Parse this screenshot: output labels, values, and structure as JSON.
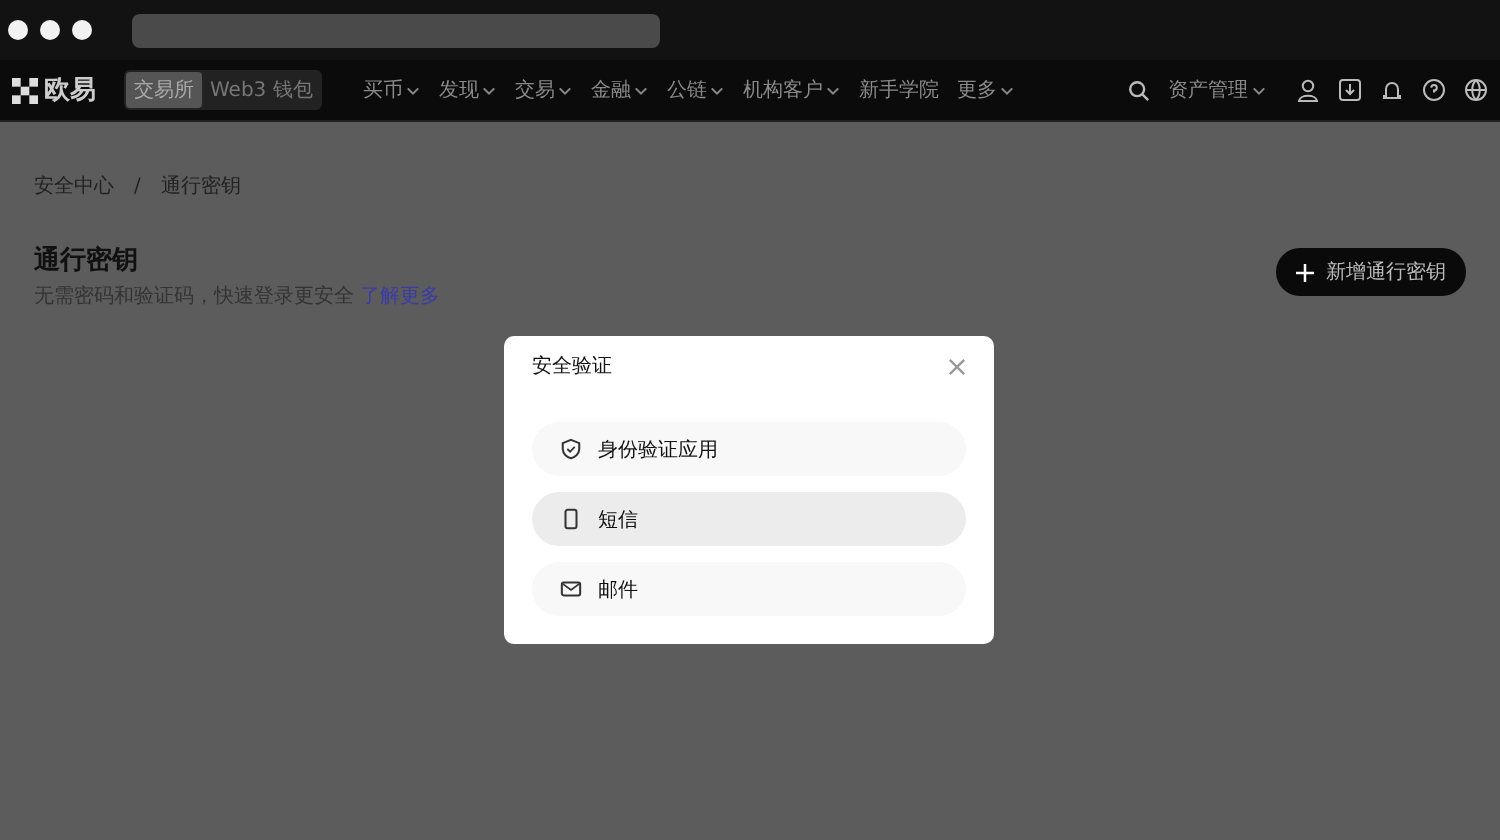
{
  "nav": {
    "logo": "欧易",
    "switch": [
      {
        "label": "交易所",
        "selected": true
      },
      {
        "label": "Web3 钱包",
        "selected": false
      }
    ],
    "menu": [
      {
        "label": "买币"
      },
      {
        "label": "发现"
      },
      {
        "label": "交易"
      },
      {
        "label": "金融"
      },
      {
        "label": "公链"
      },
      {
        "label": "机构客户"
      },
      {
        "label": "新手学院",
        "dropdown": false
      },
      {
        "label": "更多"
      }
    ],
    "assets": "资产管理"
  },
  "breadcrumb": [
    "安全中心",
    "通行密钥"
  ],
  "breadcrumb_separator": "/",
  "header": {
    "title": "通行密钥",
    "description": "无需密码和验证码，快速登录更安全",
    "link": "了解更多",
    "button": "新增通行密钥"
  },
  "dialog": {
    "title": "安全验证",
    "options": [
      {
        "label": "身份验证应用",
        "kind": "shield",
        "selected": false
      },
      {
        "label": "短信",
        "kind": "phone",
        "selected": true
      },
      {
        "label": "邮件",
        "kind": "mail",
        "selected": false
      }
    ]
  }
}
